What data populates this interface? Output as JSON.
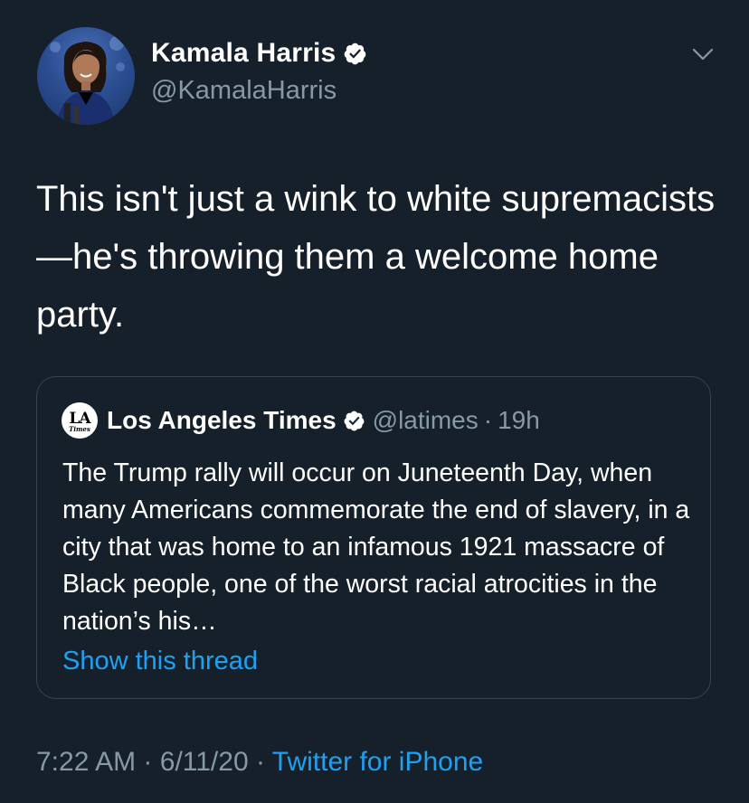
{
  "author": {
    "name": "Kamala Harris",
    "handle": "@KamalaHarris",
    "verified": true
  },
  "tweet": {
    "text": "This isn't just a wink to white supremacists—he's throwing them a welcome home party."
  },
  "quoted_tweet": {
    "logo_big": "LA",
    "logo_small": "Times",
    "name": "Los Angeles Times",
    "handle": "@latimes",
    "separator": "·",
    "time_ago": "19h",
    "text": "The Trump rally will occur on Juneteenth Day, when many Americans commemorate the end of slavery, in a city that was home to an infamous 1921 massacre of Black people, one of the worst racial atrocities in the nation’s his…",
    "show_thread_label": "Show this thread"
  },
  "meta": {
    "time": "7:22 AM",
    "separator": "·",
    "date": "6/11/20",
    "source": "Twitter for iPhone"
  },
  "icons": {
    "verified": "verified-badge-icon",
    "menu": "chevron-down-icon"
  },
  "colors": {
    "background": "#15202b",
    "secondary_text": "#8899a6",
    "link": "#1da1f2",
    "border": "#38444d"
  }
}
